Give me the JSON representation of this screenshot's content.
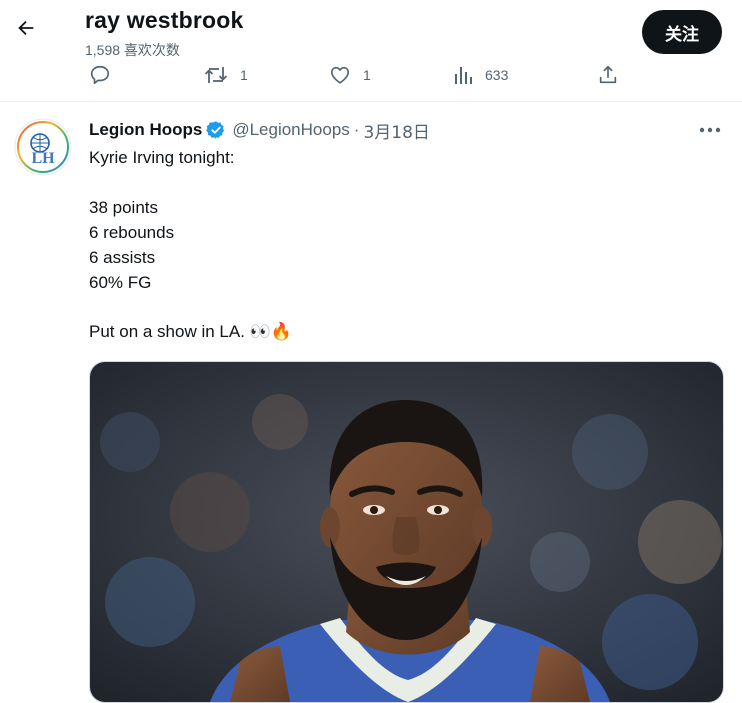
{
  "header": {
    "back_icon": "arrow-left-icon",
    "title": "ray westbrook",
    "subtitle": "1,598 喜欢次数",
    "follow_label": "关注",
    "follow_bg": "#0f1419"
  },
  "actions": {
    "reply": {
      "icon": "reply-icon",
      "count": ""
    },
    "retweet": {
      "icon": "retweet-icon",
      "count": "1"
    },
    "like": {
      "icon": "heart-icon",
      "count": "1"
    },
    "views": {
      "icon": "views-chart-icon",
      "count": "633"
    },
    "share": {
      "icon": "share-icon",
      "count": ""
    }
  },
  "tweet": {
    "author": "Legion Hoops",
    "verified_color": "#1d9bf0",
    "handle": "@LegionHoops",
    "separator": "·",
    "date": "3月18日",
    "more_icon": "more-horizontal-icon",
    "lines": [
      "Kyrie Irving tonight:",
      "38 points",
      "6 rebounds",
      "6 assists",
      "60% FG",
      "Put on a show in LA. 👀🔥"
    ],
    "avatar_monogram": "LH",
    "media_alt": "Kyrie Irving photo"
  }
}
